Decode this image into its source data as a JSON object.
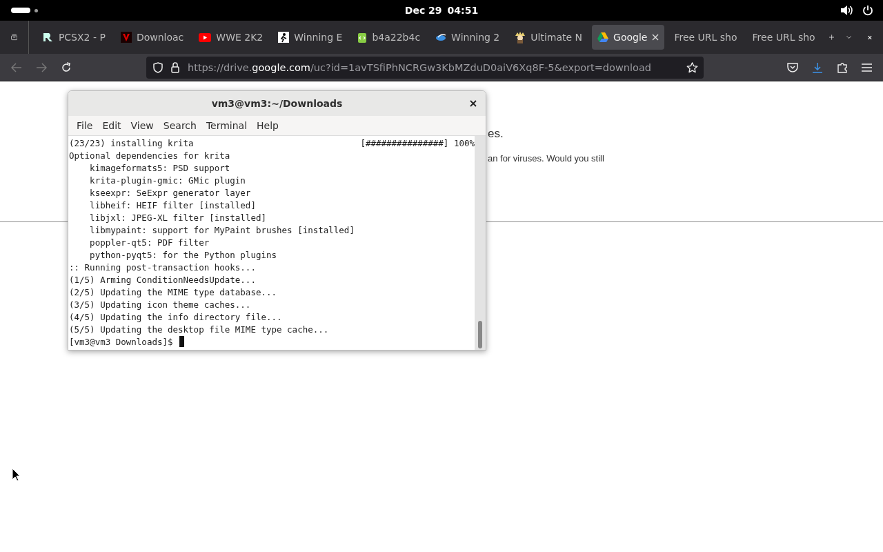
{
  "top_bar": {
    "date": "Dec 29",
    "time": "04:51"
  },
  "tabs": [
    {
      "title": "PCSX2 - P",
      "selected": false
    },
    {
      "title": "Downloac",
      "selected": false
    },
    {
      "title": "WWE 2K2",
      "selected": false
    },
    {
      "title": "Winning E",
      "selected": false
    },
    {
      "title": "b4a22b4c",
      "selected": false
    },
    {
      "title": "Winning 2",
      "selected": false
    },
    {
      "title": "Ultimate N",
      "selected": false
    },
    {
      "title": "Google",
      "selected": true
    },
    {
      "title": "Free URL sho",
      "selected": false
    },
    {
      "title": "Free URL sho",
      "selected": false
    }
  ],
  "address_bar": {
    "prefix": "https://drive.",
    "domain": "google.com",
    "path": "/uc?id=1avTSfiPhNCRGw3KbMZduD0aiV6Xq8F-5&export=download"
  },
  "page": {
    "heading_fragment": "es.",
    "text_fragment": "an for viruses. Would you still"
  },
  "terminal": {
    "title": "vm3@vm3:~/Downloads",
    "menu": [
      "File",
      "Edit",
      "View",
      "Search",
      "Terminal",
      "Help"
    ],
    "lines": [
      {
        "text": "(23/23) installing krita",
        "right": "[###############] 100%"
      },
      {
        "text": "Optional dependencies for krita"
      },
      {
        "text": "    kimageformats5: PSD support"
      },
      {
        "text": "    krita-plugin-gmic: GMic plugin"
      },
      {
        "text": "    kseexpr: SeExpr generator layer"
      },
      {
        "text": "    libheif: HEIF filter [installed]"
      },
      {
        "text": "    libjxl: JPEG-XL filter [installed]"
      },
      {
        "text": "    libmypaint: support for MyPaint brushes [installed]"
      },
      {
        "text": "    poppler-qt5: PDF filter"
      },
      {
        "text": "    python-pyqt5: for the Python plugins"
      },
      {
        "text": ":: Running post-transaction hooks..."
      },
      {
        "text": "(1/5) Arming ConditionNeedsUpdate..."
      },
      {
        "text": "(2/5) Updating the MIME type database..."
      },
      {
        "text": "(3/5) Updating icon theme caches..."
      },
      {
        "text": "(4/5) Updating the info directory file..."
      },
      {
        "text": "(5/5) Updating the desktop file MIME type cache..."
      }
    ],
    "prompt": "[vm3@vm3 Downloads]$"
  }
}
